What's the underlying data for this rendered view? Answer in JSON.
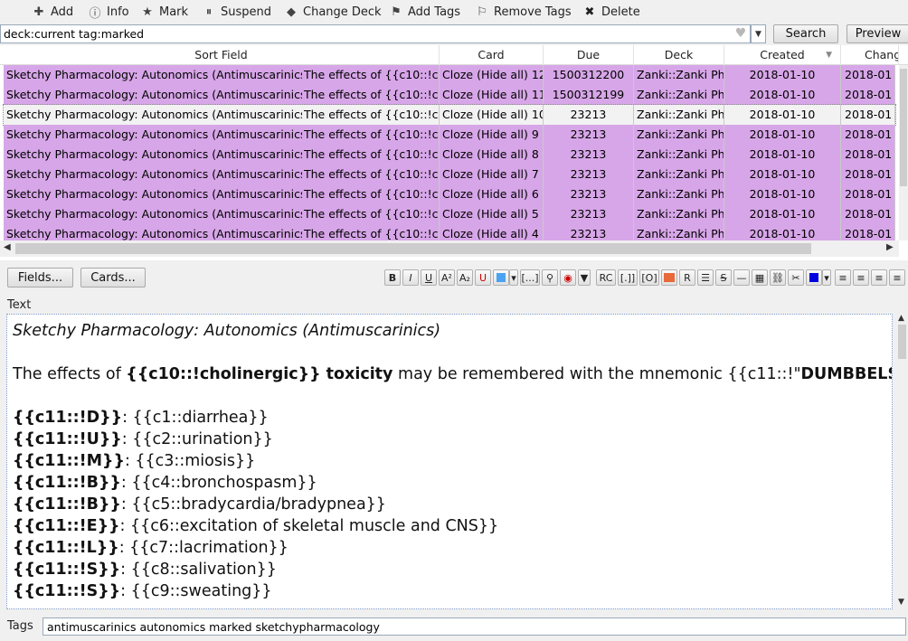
{
  "toolbar": {
    "add": "Add",
    "info": "Info",
    "mark": "Mark",
    "suspend": "Suspend",
    "change_deck": "Change Deck",
    "add_tags": "Add Tags",
    "remove_tags": "Remove Tags",
    "delete": "Delete"
  },
  "search": {
    "query": "deck:current tag:marked",
    "search_label": "Search",
    "preview_label": "Preview"
  },
  "table": {
    "headers": [
      "Sort Field",
      "Card",
      "Due",
      "Deck",
      "Created",
      "Change"
    ],
    "rows": [
      {
        "sort": "Sketchy Pharmacology: Autonomics (Antimuscarinics)",
        "field": "The effects of {{c10::!c...",
        "card": "Cloze (Hide all) 12",
        "due": "1500312200",
        "deck": "Zanki::Zanki Ph...",
        "created": "2018-01-10",
        "changed": "2018-01",
        "state": "marked"
      },
      {
        "sort": "Sketchy Pharmacology: Autonomics (Antimuscarinics)",
        "field": "The effects of {{c10::!c...",
        "card": "Cloze (Hide all) 11",
        "due": "1500312199",
        "deck": "Zanki::Zanki Ph...",
        "created": "2018-01-10",
        "changed": "2018-01",
        "state": "marked"
      },
      {
        "sort": "Sketchy Pharmacology: Autonomics (Antimuscarinics)",
        "field": "The effects of {{c10::!c...",
        "card": "Cloze (Hide all) 10",
        "due": "23213",
        "deck": "Zanki::Zanki Ph...",
        "created": "2018-01-10",
        "changed": "2018-01",
        "state": "current"
      },
      {
        "sort": "Sketchy Pharmacology: Autonomics (Antimuscarinics)",
        "field": "The effects of {{c10::!c...",
        "card": "Cloze (Hide all) 9",
        "due": "23213",
        "deck": "Zanki::Zanki Ph...",
        "created": "2018-01-10",
        "changed": "2018-01",
        "state": "marked"
      },
      {
        "sort": "Sketchy Pharmacology: Autonomics (Antimuscarinics)",
        "field": "The effects of {{c10::!c...",
        "card": "Cloze (Hide all) 8",
        "due": "23213",
        "deck": "Zanki::Zanki Ph...",
        "created": "2018-01-10",
        "changed": "2018-01",
        "state": "marked"
      },
      {
        "sort": "Sketchy Pharmacology: Autonomics (Antimuscarinics)",
        "field": "The effects of {{c10::!c...",
        "card": "Cloze (Hide all) 7",
        "due": "23213",
        "deck": "Zanki::Zanki Ph...",
        "created": "2018-01-10",
        "changed": "2018-01",
        "state": "marked"
      },
      {
        "sort": "Sketchy Pharmacology: Autonomics (Antimuscarinics)",
        "field": "The effects of {{c10::!c...",
        "card": "Cloze (Hide all) 6",
        "due": "23213",
        "deck": "Zanki::Zanki Ph...",
        "created": "2018-01-10",
        "changed": "2018-01",
        "state": "marked"
      },
      {
        "sort": "Sketchy Pharmacology: Autonomics (Antimuscarinics)",
        "field": "The effects of {{c10::!c...",
        "card": "Cloze (Hide all) 5",
        "due": "23213",
        "deck": "Zanki::Zanki Ph...",
        "created": "2018-01-10",
        "changed": "2018-01",
        "state": "marked"
      },
      {
        "sort": "Sketchy Pharmacology: Autonomics (Antimuscarinics)",
        "field": "The effects of {{c10::!c...",
        "card": "Cloze (Hide all) 4",
        "due": "23213",
        "deck": "Zanki::Zanki Ph...",
        "created": "2018-01-10",
        "changed": "2018-01",
        "state": "marked"
      }
    ]
  },
  "editor_buttons": {
    "fields": "Fields...",
    "cards": "Cards..."
  },
  "field_label": "Text",
  "editor": {
    "title_line": "Sketchy Pharmacology: Autonomics (Antimuscarinics)",
    "intro": {
      "a": "The effects of ",
      "b": "{{c10::!cholinergic}}",
      "c": " toxicity",
      "d": " may be remembered with the mnemonic {{c11::!\"",
      "e": "DUMBBELSS",
      "f": "\"}}:"
    },
    "mnemonic": [
      {
        "key": "{{c11::!D}}",
        "value": ": {{c1::diarrhea}}"
      },
      {
        "key": "{{c11::!U}}",
        "value": ": {{c2::urination}}"
      },
      {
        "key": "{{c11::!M}}",
        "value": ": {{c3::miosis}}"
      },
      {
        "key": "{{c11::!B}}",
        "value": ": {{c4::bronchospasm}}"
      },
      {
        "key": "{{c11::!B}}",
        "value": ": {{c5::bradycardia/bradypnea}}"
      },
      {
        "key": "{{c11::!E}}",
        "value": ": {{c6::excitation of skeletal muscle and CNS}}"
      },
      {
        "key": "{{c11::!L}}",
        "value": ": {{c7::lacrimation}}"
      },
      {
        "key": "{{c11::!S}}",
        "value": ": {{c8::salivation}}"
      },
      {
        "key": "{{c11::!S}}",
        "value": ": {{c9::sweating}}"
      }
    ]
  },
  "tags": {
    "label": "Tags",
    "value": "antimuscarinics autonomics marked sketchypharmacology"
  },
  "colors": {
    "marked_row": "#d7a6e8",
    "header_bg": "#ffffff",
    "editor_border": "#7a98c8"
  }
}
